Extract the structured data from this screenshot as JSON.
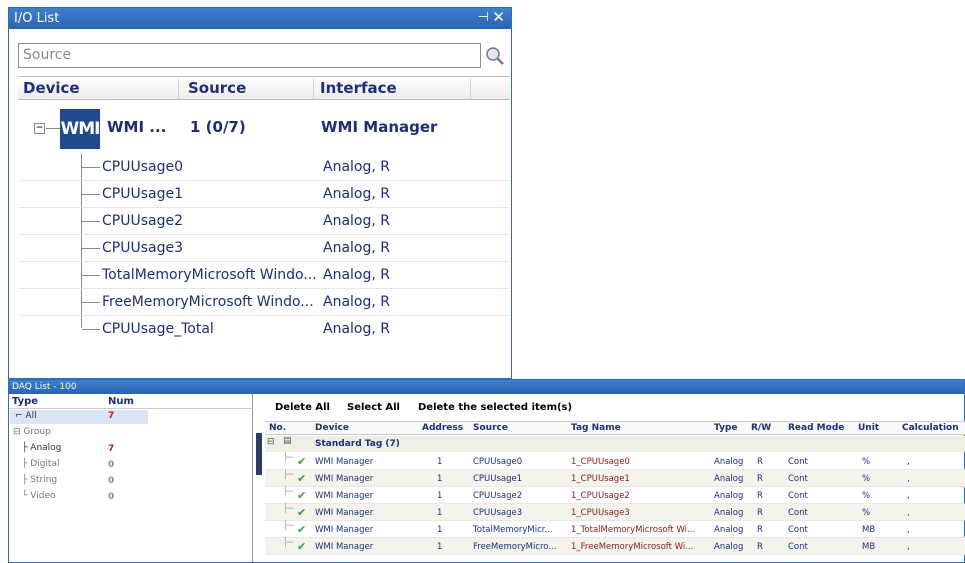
{
  "io_list": {
    "title": "I/O List",
    "search_placeholder": "Source",
    "columns": [
      "Device",
      "Source",
      "Interface"
    ],
    "device": {
      "icon_text": "WMI",
      "name": "WMI ...",
      "source": "1 (0/7)",
      "interface": "WMI Manager"
    },
    "rows": [
      {
        "source": "CPUUsage0",
        "interface": "Analog, R"
      },
      {
        "source": "CPUUsage1",
        "interface": "Analog, R"
      },
      {
        "source": "CPUUsage2",
        "interface": "Analog, R"
      },
      {
        "source": "CPUUsage3",
        "interface": "Analog, R"
      },
      {
        "source": "TotalMemoryMicrosoft Windo...",
        "interface": "Analog, R"
      },
      {
        "source": "FreeMemoryMicrosoft Windo...",
        "interface": "Analog, R"
      },
      {
        "source": "CPUUsage_Total",
        "interface": "Analog, R"
      }
    ]
  },
  "daq_list": {
    "title": "DAQ List - 100",
    "left": {
      "headers": [
        "Type",
        "Num"
      ],
      "items": [
        {
          "label": "All",
          "num": "7"
        },
        {
          "label": "Group",
          "num": ""
        },
        {
          "label": "Analog",
          "num": "7"
        },
        {
          "label": "Digital",
          "num": "0"
        },
        {
          "label": "String",
          "num": "0"
        },
        {
          "label": "Video",
          "num": "0"
        }
      ]
    },
    "toolbar": {
      "delete_all": "Delete All",
      "select_all": "Select All",
      "delete_selected": "Delete the selected item(s)"
    },
    "columns": [
      "No.",
      "Device",
      "Address",
      "Source",
      "Tag Name",
      "Type",
      "R/W",
      "Read Mode",
      "Unit",
      "Calculation"
    ],
    "group": "Standard Tag (7)",
    "rows": [
      {
        "device": "WMI Manager",
        "address": "1",
        "source": "CPUUsage0",
        "tag": "1_CPUUsage0",
        "type": "Analog",
        "rw": "R",
        "mode": "Cont",
        "unit": "%",
        "calc": ","
      },
      {
        "device": "WMI Manager",
        "address": "1",
        "source": "CPUUsage1",
        "tag": "1_CPUUsage1",
        "type": "Analog",
        "rw": "R",
        "mode": "Cont",
        "unit": "%",
        "calc": ","
      },
      {
        "device": "WMI Manager",
        "address": "1",
        "source": "CPUUsage2",
        "tag": "1_CPUUsage2",
        "type": "Analog",
        "rw": "R",
        "mode": "Cont",
        "unit": "%",
        "calc": ","
      },
      {
        "device": "WMI Manager",
        "address": "1",
        "source": "CPUUsage3",
        "tag": "1_CPUUsage3",
        "type": "Analog",
        "rw": "R",
        "mode": "Cont",
        "unit": "%",
        "calc": ","
      },
      {
        "device": "WMI Manager",
        "address": "1",
        "source": "TotalMemoryMicr...",
        "tag": "1_TotalMemoryMicrosoft Wi...",
        "type": "Analog",
        "rw": "R",
        "mode": "Cont",
        "unit": "MB",
        "calc": ","
      },
      {
        "device": "WMI Manager",
        "address": "1",
        "source": "FreeMemoryMicro...",
        "tag": "1_FreeMemoryMicrosoft Wi...",
        "type": "Analog",
        "rw": "R",
        "mode": "Cont",
        "unit": "MB",
        "calc": ","
      }
    ]
  }
}
